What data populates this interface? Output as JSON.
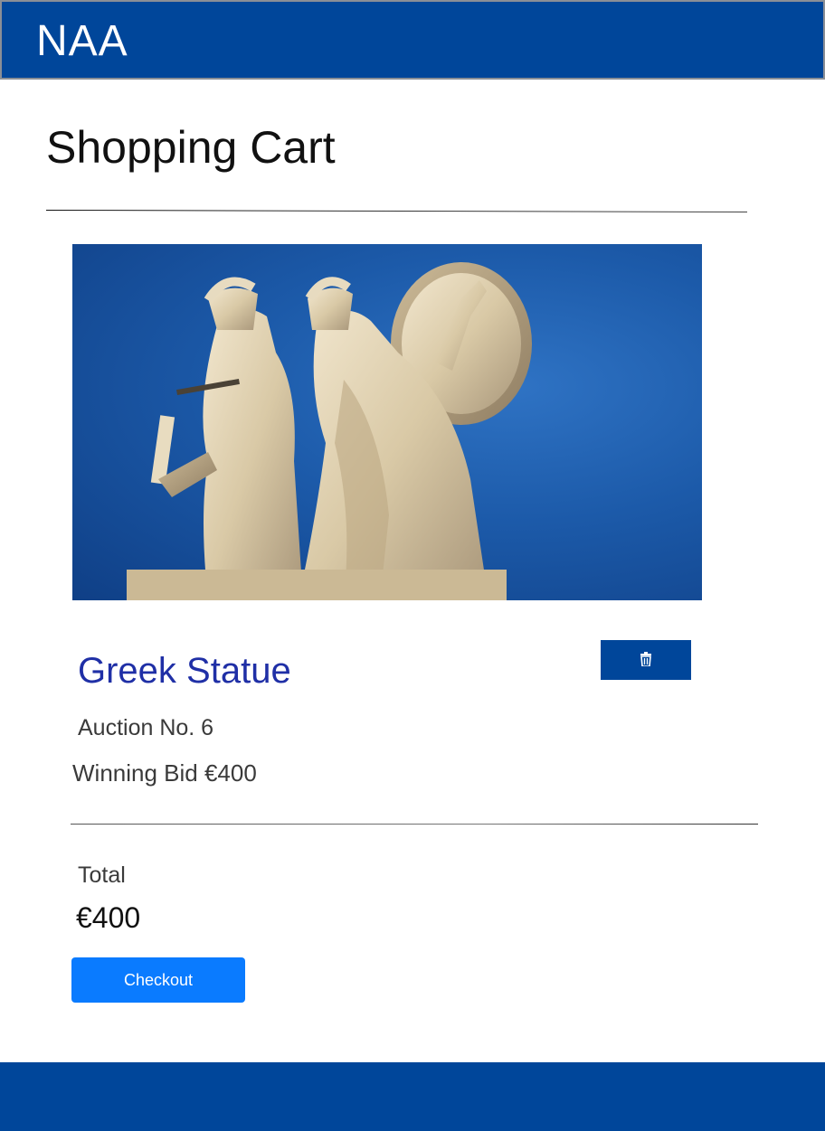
{
  "header": {
    "brand": "NAA"
  },
  "page": {
    "title": "Shopping Cart"
  },
  "cart_item": {
    "title": "Greek Statue",
    "auction_no": "Auction No. 6",
    "winning_bid": "Winning Bid €400",
    "delete_icon": "trash-icon"
  },
  "summary": {
    "total_label": "Total",
    "total_value": "€400",
    "checkout_label": "Checkout"
  },
  "colors": {
    "header_bg": "#00469a",
    "item_title": "#1f2fa6",
    "checkout_bg": "#0a7bff",
    "footer_bg": "#00469a"
  }
}
